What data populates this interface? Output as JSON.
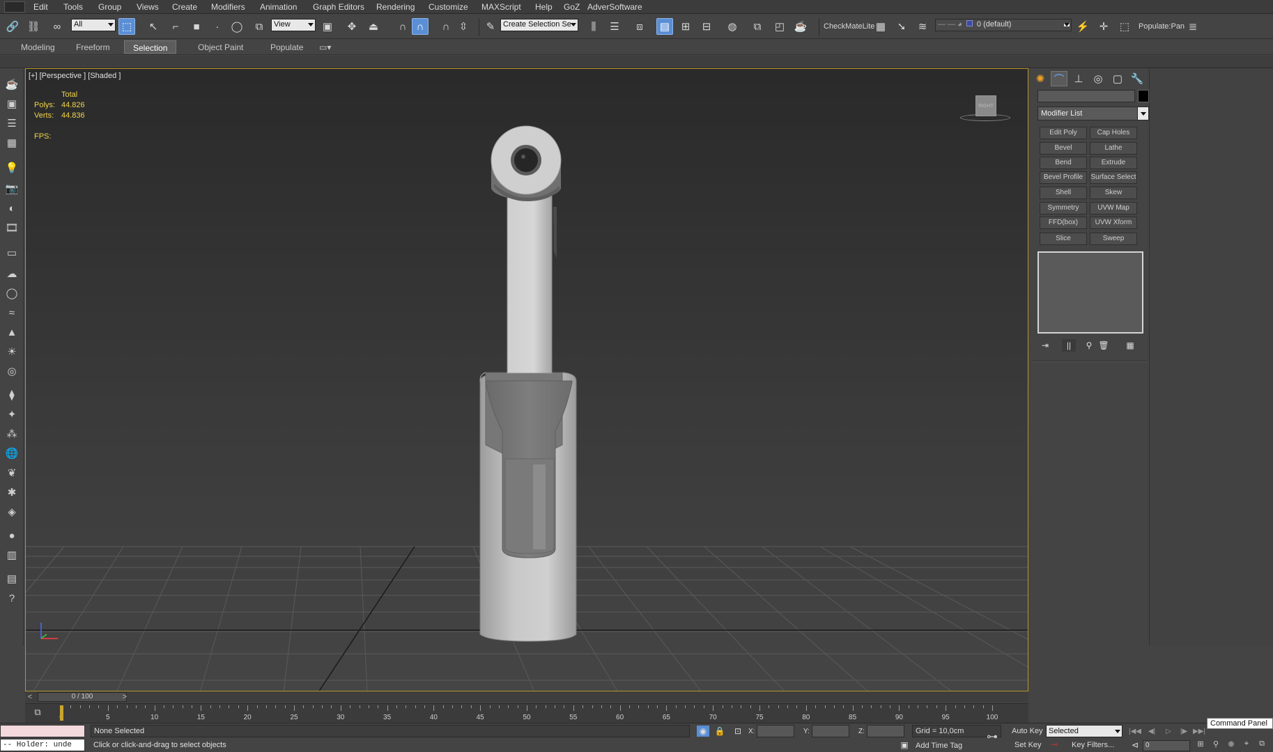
{
  "menu": {
    "items": [
      "Edit",
      "Tools",
      "Group",
      "Views",
      "Create",
      "Modifiers",
      "Animation",
      "Graph Editors",
      "Rendering",
      "Customize",
      "MAXScript",
      "Help",
      "GoZ",
      "AdverSoftware"
    ]
  },
  "toolbar": {
    "selection_filter": "All",
    "reference_coord": "View",
    "named_selection": "Create Selection Se",
    "checkmate_label": "CheckMateLite",
    "layer_select": "0 (default)",
    "populate_label": "Populate:Pan"
  },
  "ribbon": {
    "tabs": [
      {
        "label": "Modeling"
      },
      {
        "label": "Freeform"
      },
      {
        "label": "Selection"
      },
      {
        "label": "Object Paint"
      },
      {
        "label": "Populate"
      }
    ],
    "active_tab": "Selection"
  },
  "viewport": {
    "label": "[+] [Perspective ] [Shaded ]",
    "stats": {
      "header": "Total",
      "polys_label": "Polys:",
      "polys_value": "44.826",
      "verts_label": "Verts:",
      "verts_value": "44.836",
      "fps_label": "FPS:"
    },
    "viewcube_label": "RIGHT",
    "border_color": "#b8952c"
  },
  "command_panel": {
    "modifier_list_label": "Modifier List",
    "modifier_buttons": [
      [
        "Edit Poly",
        "Cap Holes"
      ],
      [
        "Bevel",
        "Lathe"
      ],
      [
        "Bend",
        "Extrude"
      ],
      [
        "Bevel Profile",
        "Surface Select"
      ],
      [
        "Shell",
        "Skew"
      ],
      [
        "Symmetry",
        "UVW Map"
      ],
      [
        "FFD(box)",
        "UVW Xform"
      ],
      [
        "Slice",
        "Sweep"
      ]
    ]
  },
  "timeline": {
    "frame_display": "0 / 100",
    "ticks": [
      "0",
      "5",
      "10",
      "15",
      "20",
      "25",
      "30",
      "35",
      "40",
      "45",
      "50",
      "55",
      "60",
      "65",
      "70",
      "75",
      "80",
      "85",
      "90",
      "95",
      "100"
    ],
    "playhead_frame": 0
  },
  "status": {
    "maxscript_output": "-- Holder: unde",
    "selection_text": "None Selected",
    "prompt_text": "Click or click-and-drag to select objects",
    "x_label": "X:",
    "y_label": "Y:",
    "z_label": "Z:",
    "grid_text": "Grid = 10,0cm",
    "add_time_tag": "Add Time Tag",
    "auto_key": "Auto Key",
    "set_key": "Set Key",
    "key_mode_select": "Selected",
    "key_filters": "Key Filters...",
    "current_frame": "0"
  },
  "tooltip": {
    "text": "Command Panel"
  }
}
